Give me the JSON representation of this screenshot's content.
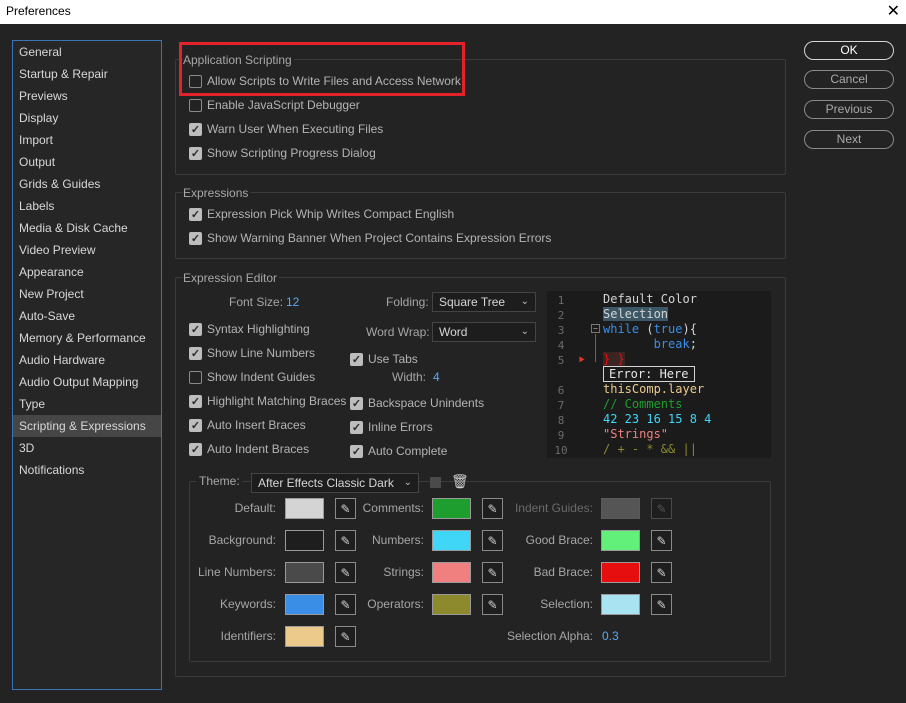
{
  "window": {
    "title": "Preferences",
    "close_glyph": "✕"
  },
  "sidebar": {
    "items": [
      {
        "label": "General",
        "active": false
      },
      {
        "label": "Startup & Repair",
        "active": false
      },
      {
        "label": "Previews",
        "active": false
      },
      {
        "label": "Display",
        "active": false
      },
      {
        "label": "Import",
        "active": false
      },
      {
        "label": "Output",
        "active": false
      },
      {
        "label": "Grids & Guides",
        "active": false
      },
      {
        "label": "Labels",
        "active": false
      },
      {
        "label": "Media & Disk Cache",
        "active": false
      },
      {
        "label": "Video Preview",
        "active": false
      },
      {
        "label": "Appearance",
        "active": false
      },
      {
        "label": "New Project",
        "active": false
      },
      {
        "label": "Auto-Save",
        "active": false
      },
      {
        "label": "Memory & Performance",
        "active": false
      },
      {
        "label": "Audio Hardware",
        "active": false
      },
      {
        "label": "Audio Output Mapping",
        "active": false
      },
      {
        "label": "Type",
        "active": false
      },
      {
        "label": "Scripting & Expressions",
        "active": true
      },
      {
        "label": "3D",
        "active": false
      },
      {
        "label": "Notifications",
        "active": false
      }
    ]
  },
  "buttons": {
    "ok": "OK",
    "cancel": "Cancel",
    "previous": "Previous",
    "next": "Next"
  },
  "app_scripting": {
    "title": "Application Scripting",
    "allow_scripts": {
      "label": "Allow Scripts to Write Files and Access Network",
      "checked": false
    },
    "enable_debugger": {
      "label": "Enable JavaScript Debugger",
      "checked": false
    },
    "warn_user": {
      "label": "Warn User When Executing Files",
      "checked": true
    },
    "show_progress": {
      "label": "Show Scripting Progress Dialog",
      "checked": true
    }
  },
  "expressions": {
    "title": "Expressions",
    "pick_whip": {
      "label": "Expression Pick Whip Writes Compact English",
      "checked": true
    },
    "warning_banner": {
      "label": "Show Warning Banner When Project Contains Expression Errors",
      "checked": true
    }
  },
  "editor": {
    "title": "Expression Editor",
    "font_size_label": "Font Size:",
    "font_size_value": "12",
    "folding_label": "Folding:",
    "folding_value": "Square Tree",
    "word_wrap_label": "Word Wrap:",
    "word_wrap_value": "Word",
    "width_label": "Width:",
    "width_value": "4",
    "syntax_highlighting": {
      "label": "Syntax Highlighting",
      "checked": true
    },
    "show_line_numbers": {
      "label": "Show Line Numbers",
      "checked": true
    },
    "show_indent_guides": {
      "label": "Show Indent Guides",
      "checked": false
    },
    "highlight_braces": {
      "label": "Highlight Matching Braces",
      "checked": true
    },
    "auto_insert_braces": {
      "label": "Auto Insert Braces",
      "checked": true
    },
    "auto_indent_braces": {
      "label": "Auto Indent Braces",
      "checked": true
    },
    "use_tabs": {
      "label": "Use Tabs",
      "checked": true
    },
    "backspace_unindents": {
      "label": "Backspace Unindents",
      "checked": true
    },
    "inline_errors": {
      "label": "Inline Errors",
      "checked": true
    },
    "auto_complete": {
      "label": "Auto Complete",
      "checked": true
    }
  },
  "code_preview": {
    "line_numbers": [
      "1",
      "2",
      "3",
      "4",
      "5",
      "6",
      "7",
      "8",
      "9",
      "10"
    ],
    "default_color": "Default Color",
    "selection": "Selection",
    "kw_while": "while",
    "paren_open": " (",
    "kw_true": "true",
    "paren_close": "){",
    "break_indent": "       ",
    "kw_break": "break",
    "semicolon": ";",
    "error_braces": "} }",
    "error_box": "Error: Here",
    "this_comp": "thisComp.layer",
    "comment": "// Comments",
    "numbers": "42 23 16 15 8 4",
    "strings": "\"Strings\"",
    "operators": "/ + - * && ||"
  },
  "theme": {
    "label": "Theme:",
    "value": "After Effects Classic Dark",
    "colors": {
      "default": {
        "label": "Default:",
        "hex": "#d4d4d4"
      },
      "background": {
        "label": "Background:",
        "hex": "#1e1e1e"
      },
      "line_numbers": {
        "label": "Line Numbers:",
        "hex": "#4a4a4a"
      },
      "keywords": {
        "label": "Keywords:",
        "hex": "#3a8ee6"
      },
      "identifiers": {
        "label": "Identifiers:",
        "hex": "#ecca8c"
      },
      "comments": {
        "label": "Comments:",
        "hex": "#1e9e2e"
      },
      "numbers": {
        "label": "Numbers:",
        "hex": "#3fd6f7"
      },
      "strings": {
        "label": "Strings:",
        "hex": "#f08080"
      },
      "operators": {
        "label": "Operators:",
        "hex": "#8c8a2c"
      },
      "indent_guides": {
        "label": "Indent Guides:",
        "hex": "#555555"
      },
      "good_brace": {
        "label": "Good Brace:",
        "hex": "#63f07a"
      },
      "bad_brace": {
        "label": "Bad Brace:",
        "hex": "#e60e0e"
      },
      "selection": {
        "label": "Selection:",
        "hex": "#a9e2f0"
      }
    },
    "selection_alpha_label": "Selection Alpha:",
    "selection_alpha_value": "0.3"
  }
}
